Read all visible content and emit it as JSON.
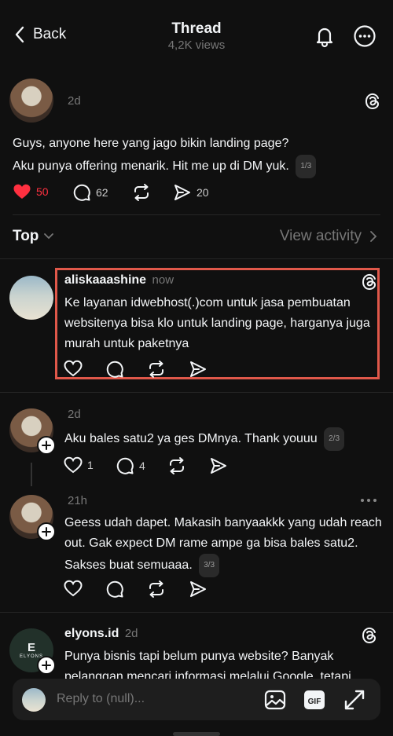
{
  "header": {
    "back_label": "Back",
    "title": "Thread",
    "views": "4,2K views"
  },
  "original_post": {
    "time": "2d",
    "line1": "Guys, anyone here yang jago bikin landing page?",
    "line2": "Aku punya offering menarik. Hit me up di DM yuk.",
    "badge": "1/3",
    "likes": "50",
    "comments": "62",
    "shares": "20"
  },
  "sort": {
    "label": "Top",
    "view_activity": "View activity"
  },
  "replies": [
    {
      "username": "aliskaaashine",
      "time": "now",
      "text": "Ke layanan idwebhost(.)com untuk jasa pembuatan websitenya bisa klo untuk landing page, harganya juga murah untuk paketnya"
    },
    {
      "time": "2d",
      "text": "Aku bales satu2 ya ges DMnya. Thank youuu",
      "badge": "2/3",
      "likes": "1",
      "comments": "4"
    },
    {
      "time": "21h",
      "text": "Geess udah dapet. Makasih banyaakkk yang udah reach out. Gak expect DM rame ampe ga bisa bales satu2. Sakses buat semuaaa.",
      "badge": "3/3"
    },
    {
      "username": "elyons.id",
      "time": "2d",
      "avatar_text": "ELYONS",
      "text": "Punya bisnis tapi belum punya website? Banyak pelanggan mencari informasi melalui Google, tetapi"
    }
  ],
  "reply_bar": {
    "placeholder": "Reply to (null)..."
  },
  "colors": {
    "background": "#101010",
    "like_red": "#ff3040",
    "highlight_box": "#e0584a"
  }
}
